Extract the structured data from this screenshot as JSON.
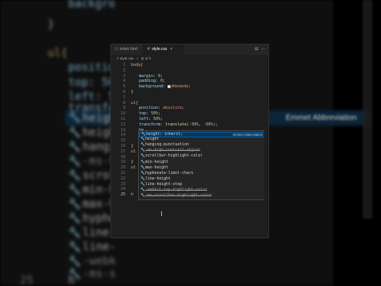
{
  "background": {
    "line_numbers": [
      "",
      "",
      "",
      "",
      "",
      "",
      "",
      "",
      "",
      "",
      "",
      "",
      "",
      "",
      "",
      "",
      "",
      "",
      "",
      "",
      "",
      "",
      "25"
    ],
    "lines": [
      "backgro",
      "}",
      "",
      "ul{",
      "positio",
      "top: 50",
      "left: 5",
      "transfor",
      "height",
      "heigh",
      "hangi",
      "-ms-h",
      "scrol",
      "min-h",
      "max-h",
      "hyphe",
      "line-",
      "line-",
      "-webk",
      "-ms-s",
      "h"
    ],
    "emmet_label": "Emmet Abbreviation"
  },
  "tabs": [
    {
      "icon": "U",
      "label": "index.html",
      "active": false
    },
    {
      "icon": "#",
      "label": "style.css",
      "active": true,
      "close": "×"
    }
  ],
  "tab_actions": [
    "⊟",
    "···"
  ],
  "breadcrumb": {
    "file": "style.css",
    "sep": ">",
    "selector": "ul h"
  },
  "line_numbers": [
    "1",
    "2",
    "3",
    "4",
    "5",
    "6",
    "7",
    "8",
    "9",
    "10",
    "11",
    "12",
    "13",
    "14",
    "15",
    "16",
    "17",
    "18",
    "19",
    "20",
    "21",
    "22",
    "23",
    "24",
    "25"
  ],
  "code": {
    "l1": "body{",
    "l3_prop": "margin",
    "l3_val": "0",
    "l4_prop": "padding",
    "l4_val": "0",
    "l5_prop": "background",
    "l5_val": "#dedede",
    "l6": "}",
    "l8": "ul{",
    "l9_prop": "position",
    "l9_val": "absolute",
    "l10_prop": "top",
    "l10_val": "50%",
    "l11_prop": "left",
    "l11_val": "50%",
    "l12_prop": "transform",
    "l12_fn": "translate",
    "l12_args": "(-50%, -50%)",
    "l13": "he",
    "l16": "}",
    "l17": "ul h",
    "l19": "}",
    "l20": "ul h",
    "l25": "h"
  },
  "suggestions": [
    {
      "label": "height: inherit;",
      "detail": "Emmet Abbreviation",
      "deprecated": false
    },
    {
      "label": "height",
      "deprecated": false
    },
    {
      "label": "hanging-punctuation",
      "deprecated": false
    },
    {
      "label": "-ms-high-contrast-adjust",
      "deprecated": true
    },
    {
      "label": "scrollbar-highlight-color",
      "deprecated": false
    },
    {
      "label": "min-height",
      "deprecated": false
    },
    {
      "label": "max-height",
      "deprecated": false
    },
    {
      "label": "hyphenate-limit-chars",
      "deprecated": false
    },
    {
      "label": "line-height",
      "deprecated": false
    },
    {
      "label": "line-height-step",
      "deprecated": false
    },
    {
      "label": "-webkit-tap-highlight-color",
      "deprecated": true
    },
    {
      "label": "-ms-scrollbar-highlight-color",
      "deprecated": true
    }
  ],
  "colors": {
    "accent": "#0b5aa0",
    "editor_bg": "#1e1e1e",
    "selector": "#d7ba7d",
    "property": "#9cdcfe"
  }
}
